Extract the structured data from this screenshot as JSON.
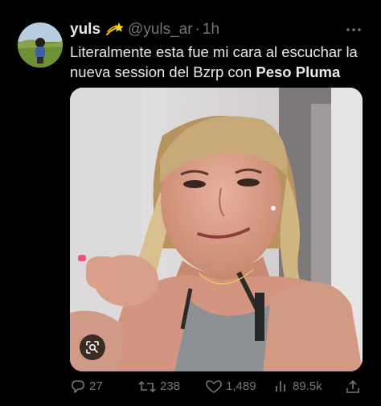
{
  "author": {
    "display_name": "yuls",
    "handle": "@yuls_ar",
    "separator": "·",
    "time": "1h",
    "emoji_icon": "dizzy-star-icon"
  },
  "tweet": {
    "text_prefix": "Literalmente esta fue mi cara al escuchar la nueva session del Bzrp con ",
    "text_bold": "Peso Pluma"
  },
  "media": {
    "icon": "lens-icon"
  },
  "actions": {
    "replies": "27",
    "reposts": "238",
    "likes": "1,489",
    "views": "89.5k"
  },
  "colors": {
    "background": "#000000",
    "text": "#e7e9ea",
    "muted": "#71767b"
  }
}
